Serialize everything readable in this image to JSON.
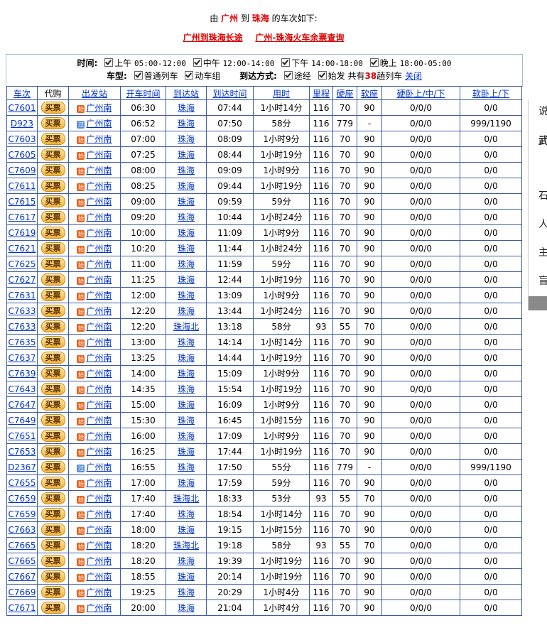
{
  "header": {
    "prefix": "由",
    "from": "广州",
    "mid": "到",
    "to": "珠海",
    "suffix": "的车次如下:"
  },
  "links": {
    "bus": "广州到珠海长途",
    "tickets": "广州-珠海火车余票查询"
  },
  "filters": {
    "time_label": "时间:",
    "times": [
      {
        "name": "上午",
        "range": "05:00-12:00"
      },
      {
        "name": "中午",
        "range": "12:00-14:00"
      },
      {
        "name": "下午",
        "range": "14:00-18:00"
      },
      {
        "name": "晚上",
        "range": "18:00-05:00"
      }
    ],
    "type_label": "车型:",
    "type_normal": "普通列车",
    "type_emu": "动车组",
    "arrive_label": "到达方式:",
    "arrive_pass": "途经",
    "arrive_origin": "始发",
    "total_prefix": "共有",
    "total_count": "38",
    "total_suffix": "趟列车",
    "close": "关闭"
  },
  "table": {
    "headers": [
      "车次",
      "代购",
      "出发站",
      "开车时间",
      "到达站",
      "到达时间",
      "用时",
      "里程",
      "硬座",
      "软座",
      "硬卧上/中/下",
      "软卧上/下"
    ],
    "buy_label": "买票",
    "rows": [
      [
        "C7601",
        "广州南",
        "06:30",
        "珠海",
        "07:44",
        "1小时14分",
        "116",
        "70",
        "90",
        "0/0/0",
        "0/0",
        "start"
      ],
      [
        "D923",
        "广州南",
        "06:52",
        "珠海",
        "07:50",
        "58分",
        "116",
        "779",
        "-",
        "0/0/0",
        "999/1190",
        "pass"
      ],
      [
        "C7603",
        "广州南",
        "07:00",
        "珠海",
        "08:09",
        "1小时9分",
        "116",
        "70",
        "90",
        "0/0/0",
        "0/0",
        "start"
      ],
      [
        "C7605",
        "广州南",
        "07:25",
        "珠海",
        "08:44",
        "1小时19分",
        "116",
        "70",
        "90",
        "0/0/0",
        "0/0",
        "start"
      ],
      [
        "C7609",
        "广州南",
        "08:00",
        "珠海",
        "09:09",
        "1小时9分",
        "116",
        "70",
        "90",
        "0/0/0",
        "0/0",
        "start"
      ],
      [
        "C7611",
        "广州南",
        "08:25",
        "珠海",
        "09:44",
        "1小时19分",
        "116",
        "70",
        "90",
        "0/0/0",
        "0/0",
        "start"
      ],
      [
        "C7615",
        "广州南",
        "09:00",
        "珠海",
        "09:59",
        "59分",
        "116",
        "70",
        "90",
        "0/0/0",
        "0/0",
        "start"
      ],
      [
        "C7617",
        "广州南",
        "09:20",
        "珠海",
        "10:44",
        "1小时24分",
        "116",
        "70",
        "90",
        "0/0/0",
        "0/0",
        "start"
      ],
      [
        "C7619",
        "广州南",
        "10:00",
        "珠海",
        "11:09",
        "1小时9分",
        "116",
        "70",
        "90",
        "0/0/0",
        "0/0",
        "start"
      ],
      [
        "C7621",
        "广州南",
        "10:20",
        "珠海",
        "11:44",
        "1小时24分",
        "116",
        "70",
        "90",
        "0/0/0",
        "0/0",
        "start"
      ],
      [
        "C7625",
        "广州南",
        "11:00",
        "珠海",
        "11:59",
        "59分",
        "116",
        "70",
        "90",
        "0/0/0",
        "0/0",
        "start"
      ],
      [
        "C7627",
        "广州南",
        "11:25",
        "珠海",
        "12:44",
        "1小时19分",
        "116",
        "70",
        "90",
        "0/0/0",
        "0/0",
        "start"
      ],
      [
        "C7631",
        "广州南",
        "12:00",
        "珠海",
        "13:09",
        "1小时9分",
        "116",
        "70",
        "90",
        "0/0/0",
        "0/0",
        "start"
      ],
      [
        "C7633",
        "广州南",
        "12:20",
        "珠海",
        "13:44",
        "1小时24分",
        "116",
        "70",
        "90",
        "0/0/0",
        "0/0",
        "start"
      ],
      [
        "C7633",
        "广州南",
        "12:20",
        "珠海北",
        "13:18",
        "58分",
        "93",
        "55",
        "70",
        "0/0/0",
        "0/0",
        "start"
      ],
      [
        "C7635",
        "广州南",
        "13:00",
        "珠海",
        "14:14",
        "1小时14分",
        "116",
        "70",
        "90",
        "0/0/0",
        "0/0",
        "start"
      ],
      [
        "C7637",
        "广州南",
        "13:25",
        "珠海",
        "14:44",
        "1小时19分",
        "116",
        "70",
        "90",
        "0/0/0",
        "0/0",
        "start"
      ],
      [
        "C7639",
        "广州南",
        "14:00",
        "珠海",
        "15:09",
        "1小时9分",
        "116",
        "70",
        "90",
        "0/0/0",
        "0/0",
        "start"
      ],
      [
        "C7643",
        "广州南",
        "14:35",
        "珠海",
        "15:54",
        "1小时19分",
        "116",
        "70",
        "90",
        "0/0/0",
        "0/0",
        "start"
      ],
      [
        "C7647",
        "广州南",
        "15:00",
        "珠海",
        "16:09",
        "1小时9分",
        "116",
        "70",
        "90",
        "0/0/0",
        "0/0",
        "start"
      ],
      [
        "C7649",
        "广州南",
        "15:30",
        "珠海",
        "16:45",
        "1小时15分",
        "116",
        "70",
        "90",
        "0/0/0",
        "0/0",
        "start"
      ],
      [
        "C7651",
        "广州南",
        "16:00",
        "珠海",
        "17:09",
        "1小时9分",
        "116",
        "70",
        "90",
        "0/0/0",
        "0/0",
        "start"
      ],
      [
        "C7653",
        "广州南",
        "16:25",
        "珠海",
        "17:44",
        "1小时19分",
        "116",
        "70",
        "90",
        "0/0/0",
        "0/0",
        "start"
      ],
      [
        "D2367",
        "广州南",
        "16:55",
        "珠海",
        "17:50",
        "55分",
        "116",
        "779",
        "-",
        "0/0/0",
        "999/1190",
        "pass"
      ],
      [
        "C7655",
        "广州南",
        "17:00",
        "珠海",
        "17:59",
        "59分",
        "116",
        "70",
        "90",
        "0/0/0",
        "0/0",
        "start"
      ],
      [
        "C7659",
        "广州南",
        "17:40",
        "珠海北",
        "18:33",
        "53分",
        "93",
        "55",
        "70",
        "0/0/0",
        "0/0",
        "start"
      ],
      [
        "C7659",
        "广州南",
        "17:40",
        "珠海",
        "18:54",
        "1小时14分",
        "116",
        "70",
        "90",
        "0/0/0",
        "0/0",
        "start"
      ],
      [
        "C7663",
        "广州南",
        "18:00",
        "珠海",
        "19:15",
        "1小时15分",
        "116",
        "70",
        "90",
        "0/0/0",
        "0/0",
        "start"
      ],
      [
        "C7665",
        "广州南",
        "18:20",
        "珠海北",
        "19:18",
        "58分",
        "93",
        "55",
        "70",
        "0/0/0",
        "0/0",
        "start"
      ],
      [
        "C7665",
        "广州南",
        "18:20",
        "珠海",
        "19:39",
        "1小时19分",
        "116",
        "70",
        "90",
        "0/0/0",
        "0/0",
        "start"
      ],
      [
        "C7667",
        "广州南",
        "18:55",
        "珠海",
        "20:14",
        "1小时19分",
        "116",
        "70",
        "90",
        "0/0/0",
        "0/0",
        "start"
      ],
      [
        "C7669",
        "广州南",
        "19:25",
        "珠海",
        "20:29",
        "1小时4分",
        "116",
        "70",
        "90",
        "0/0/0",
        "0/0",
        "start"
      ],
      [
        "C7671",
        "广州南",
        "20:00",
        "珠海",
        "21:04",
        "1小时4分",
        "116",
        "70",
        "90",
        "0/0/0",
        "0/0",
        "start"
      ]
    ]
  },
  "sidebar": {
    "chars": [
      "说",
      "武",
      "",
      "石",
      "人",
      "主",
      "盲"
    ]
  },
  "icons": {
    "start_icon": "始",
    "pass_icon": "过"
  }
}
